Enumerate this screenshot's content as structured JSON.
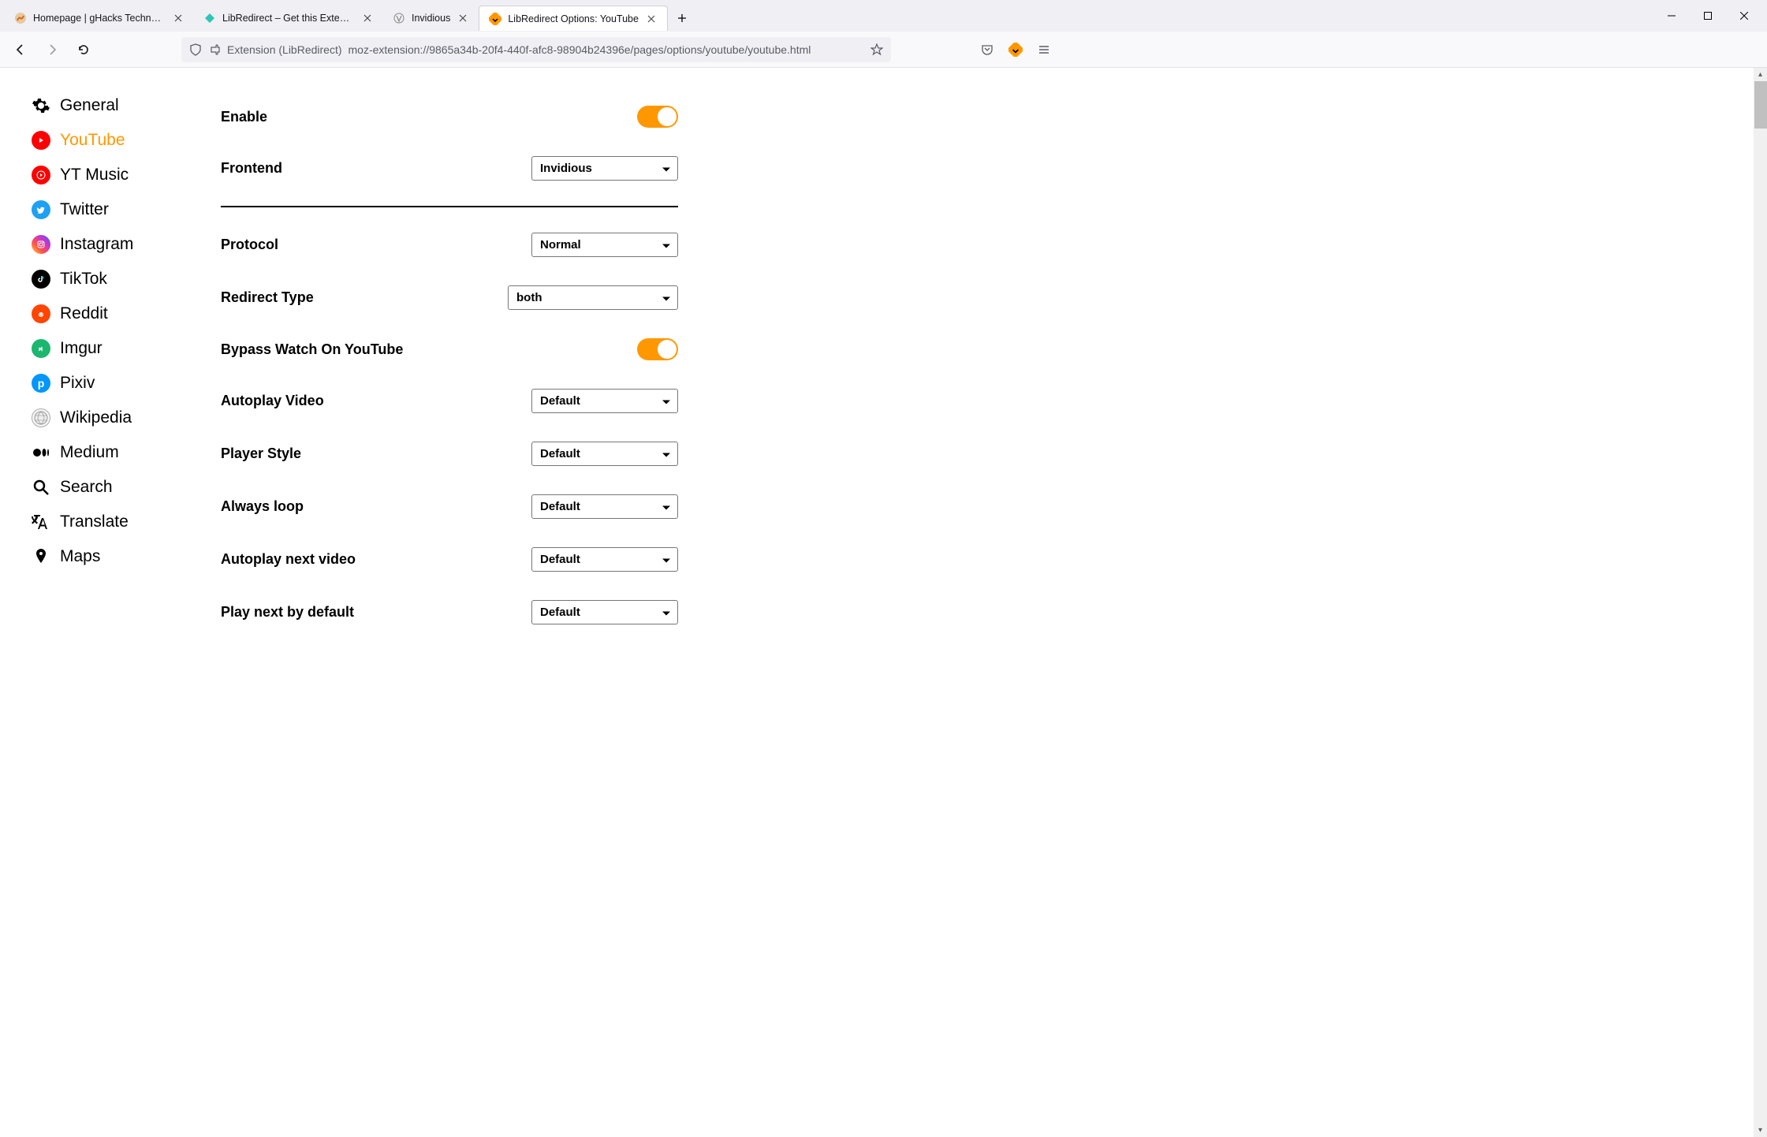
{
  "browser": {
    "tabs": [
      {
        "title": "Homepage | gHacks Technolog",
        "favicon": "ghacks",
        "active": false
      },
      {
        "title": "LibRedirect – Get this Extension",
        "favicon": "libredirect",
        "active": false
      },
      {
        "title": "Invidious",
        "favicon": "invidious",
        "active": false
      },
      {
        "title": "LibRedirect Options: YouTube",
        "favicon": "libredirect-ext",
        "active": true
      }
    ],
    "url_label": "Extension (LibRedirect)",
    "url": "moz-extension://9865a34b-20f4-440f-afc8-98904b24396e/pages/options/youtube/youtube.html"
  },
  "sidebar": {
    "items": [
      {
        "label": "General",
        "icon": "gear"
      },
      {
        "label": "YouTube",
        "icon": "youtube",
        "active": true
      },
      {
        "label": "YT Music",
        "icon": "ytmusic"
      },
      {
        "label": "Twitter",
        "icon": "twitter"
      },
      {
        "label": "Instagram",
        "icon": "instagram"
      },
      {
        "label": "TikTok",
        "icon": "tiktok"
      },
      {
        "label": "Reddit",
        "icon": "reddit"
      },
      {
        "label": "Imgur",
        "icon": "imgur"
      },
      {
        "label": "Pixiv",
        "icon": "pixiv"
      },
      {
        "label": "Wikipedia",
        "icon": "wikipedia"
      },
      {
        "label": "Medium",
        "icon": "medium"
      },
      {
        "label": "Search",
        "icon": "search"
      },
      {
        "label": "Translate",
        "icon": "translate"
      },
      {
        "label": "Maps",
        "icon": "maps"
      }
    ]
  },
  "settings": {
    "enable": {
      "label": "Enable",
      "value": true
    },
    "frontend": {
      "label": "Frontend",
      "value": "Invidious"
    },
    "protocol": {
      "label": "Protocol",
      "value": "Normal"
    },
    "redirect_type": {
      "label": "Redirect Type",
      "value": "both"
    },
    "bypass": {
      "label": "Bypass Watch On YouTube",
      "value": true
    },
    "autoplay_video": {
      "label": "Autoplay Video",
      "value": "Default"
    },
    "player_style": {
      "label": "Player Style",
      "value": "Default"
    },
    "always_loop": {
      "label": "Always loop",
      "value": "Default"
    },
    "autoplay_next": {
      "label": "Autoplay next video",
      "value": "Default"
    },
    "play_next": {
      "label": "Play next by default",
      "value": "Default"
    }
  }
}
